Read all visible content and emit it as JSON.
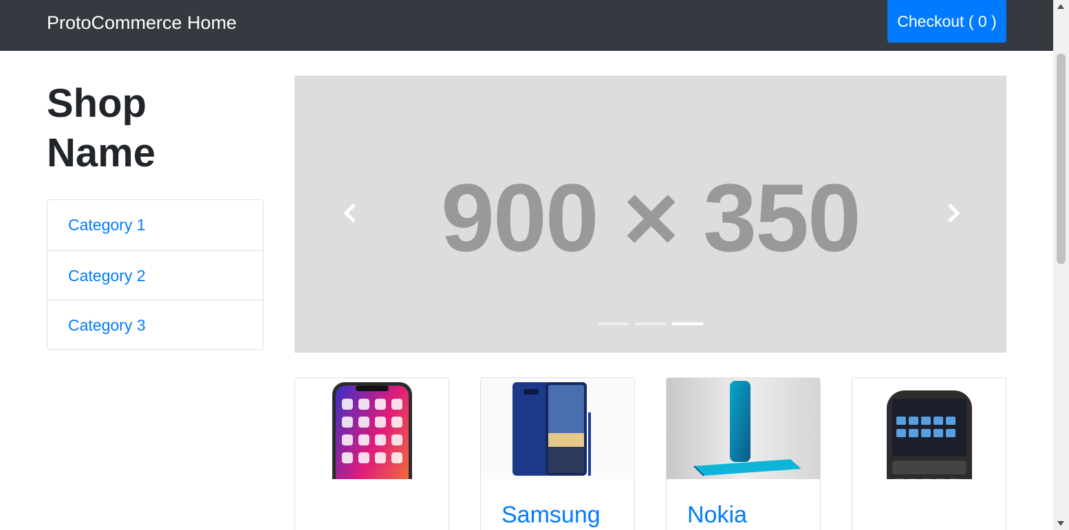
{
  "navbar": {
    "brand": "ProtoCommerce Home",
    "checkout_label": "Checkout ( 0 )"
  },
  "sidebar": {
    "shop_name": "Shop Name",
    "categories": [
      {
        "label": "Category 1"
      },
      {
        "label": "Category 2"
      },
      {
        "label": "Category 3"
      }
    ]
  },
  "carousel": {
    "placeholder_text": "900 × 350",
    "prev_icon": "chevron-left-icon",
    "next_icon": "chevron-right-icon",
    "slide_count": 3,
    "active_slide": 3
  },
  "products": [
    {
      "name": "",
      "image": "iphone-x-image"
    },
    {
      "name": "Samsung",
      "image": "samsung-note8-image"
    },
    {
      "name": "Nokia",
      "image": "nokia-edge-image"
    },
    {
      "name": "",
      "image": "blackberry-image"
    }
  ],
  "colors": {
    "navbar_bg": "#343a40",
    "primary": "#007bff",
    "carousel_bg": "#dddddd",
    "placeholder_text": "#999999"
  }
}
